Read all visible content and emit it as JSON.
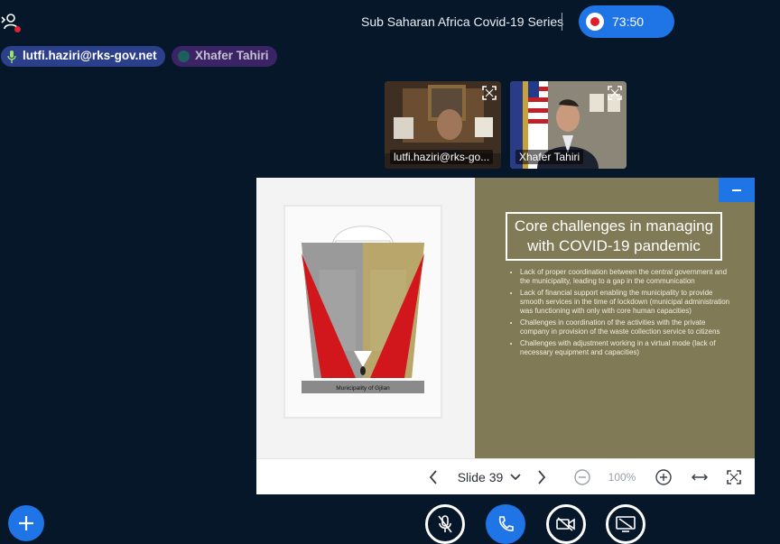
{
  "header": {
    "meeting_title": "Sub Saharan Africa Covid-19 Series",
    "recording_time": "73:50"
  },
  "talkers": [
    {
      "name": "lutfi.haziri@rks-gov.net",
      "talking": true
    },
    {
      "name": "Xhafer Tahiri",
      "talking": false
    }
  ],
  "webcams": [
    {
      "name": "lutfi.haziri@rks-go..."
    },
    {
      "name": "Xhafer Tahiri"
    }
  ],
  "slide": {
    "logo_caption": "Municipality of Gjilan",
    "title": "Core challenges in managing with  COVID-19 pandemic",
    "bullets": [
      "Lack of proper coordination between the central government and the municipality, leading to a gap in the communication",
      "Lack of financial support enabling the municipality to provide smooth services in the time of lockdown (municipal administration was functioning with only with core human capacities)",
      "Challenges in coordination of the activities with the private company in provision of the waste collection service to citizens",
      "Challenges with adjustment working in a virtual mode (lack of necessary equipment and capacities)"
    ]
  },
  "toolbar": {
    "slide_label": "Slide 39",
    "zoom": "100%"
  },
  "colors": {
    "background": "#06172a",
    "accent": "#1f74e6",
    "record_red": "#dd1f2b",
    "slide_olive": "#807a56"
  },
  "icons": [
    "users-icon",
    "record-icon",
    "mic-icon",
    "fullscreen-icon",
    "minimize-icon",
    "chevron-left-icon",
    "chevron-down-icon",
    "chevron-right-icon",
    "zoom-out-icon",
    "zoom-in-icon",
    "fit-width-icon",
    "fit-screen-icon",
    "plus-icon",
    "mic-off-icon",
    "phone-icon",
    "video-off-icon",
    "screenshare-off-icon"
  ]
}
